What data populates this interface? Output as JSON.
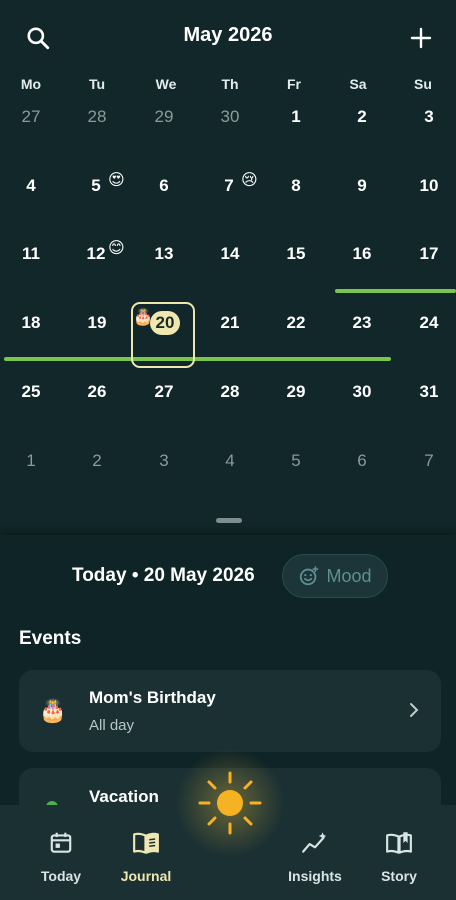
{
  "header": {
    "title": "May 2026",
    "search_icon": "search-icon",
    "add_icon": "plus-icon"
  },
  "weekdays": [
    "Mo",
    "Tu",
    "We",
    "Th",
    "Fr",
    "Sa",
    "Su"
  ],
  "weeks": [
    [
      "27",
      "28",
      "29",
      "30",
      "1",
      "2",
      "3"
    ],
    [
      "4",
      "5",
      "6",
      "7",
      "8",
      "9",
      "10"
    ],
    [
      "11",
      "12",
      "13",
      "14",
      "15",
      "16",
      "17"
    ],
    [
      "18",
      "19",
      "20",
      "21",
      "22",
      "23",
      "24"
    ],
    [
      "25",
      "26",
      "27",
      "28",
      "29",
      "30",
      "31"
    ],
    [
      "1",
      "2",
      "3",
      "4",
      "5",
      "6",
      "7"
    ]
  ],
  "day_emojis": {
    "5": "😍",
    "7": "😢",
    "12": "😊",
    "20": "🎂"
  },
  "today_label": "20",
  "detail": {
    "date_line": "Today • 20 May 2026",
    "mood_label": "Mood",
    "events_heading": "Events"
  },
  "events": [
    {
      "title": "Mom's Birthday",
      "subtitle": "All day",
      "icon": "🎂"
    },
    {
      "title": "Vacation",
      "subtitle": "",
      "icon": "green-dot"
    }
  ],
  "nav": [
    {
      "label": "Today",
      "icon": "calendar-icon"
    },
    {
      "label": "Journal",
      "icon": "book-icon"
    },
    {
      "label": "Insights",
      "icon": "chart-icon"
    },
    {
      "label": "Story",
      "icon": "story-icon"
    }
  ],
  "colors": {
    "background": "#0f2426",
    "accent": "#efe6b0",
    "range_bar": "#7bc54d",
    "card": "#1a3033"
  }
}
